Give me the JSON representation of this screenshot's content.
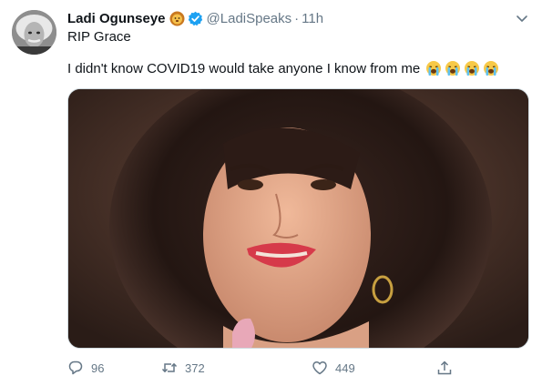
{
  "author": {
    "display_name": "Ladi Ogunseye",
    "handle": "@LadiSpeaks",
    "separator": "·",
    "time": "11h",
    "name_emoji": "lion-face-icon",
    "verified_icon": "verified-badge-icon"
  },
  "tweet": {
    "subtitle": "RIP Grace",
    "text": "I didn't know COVID19 would take anyone I know from me",
    "emoji": [
      "loudly-crying-face-icon",
      "loudly-crying-face-icon",
      "loudly-crying-face-icon",
      "loudly-crying-face-icon"
    ]
  },
  "actions": {
    "reply_count": "96",
    "retweet_count": "372",
    "like_count": "449"
  },
  "colors": {
    "muted": "#657786",
    "verified": "#1da1f2",
    "text": "#0f1419"
  }
}
